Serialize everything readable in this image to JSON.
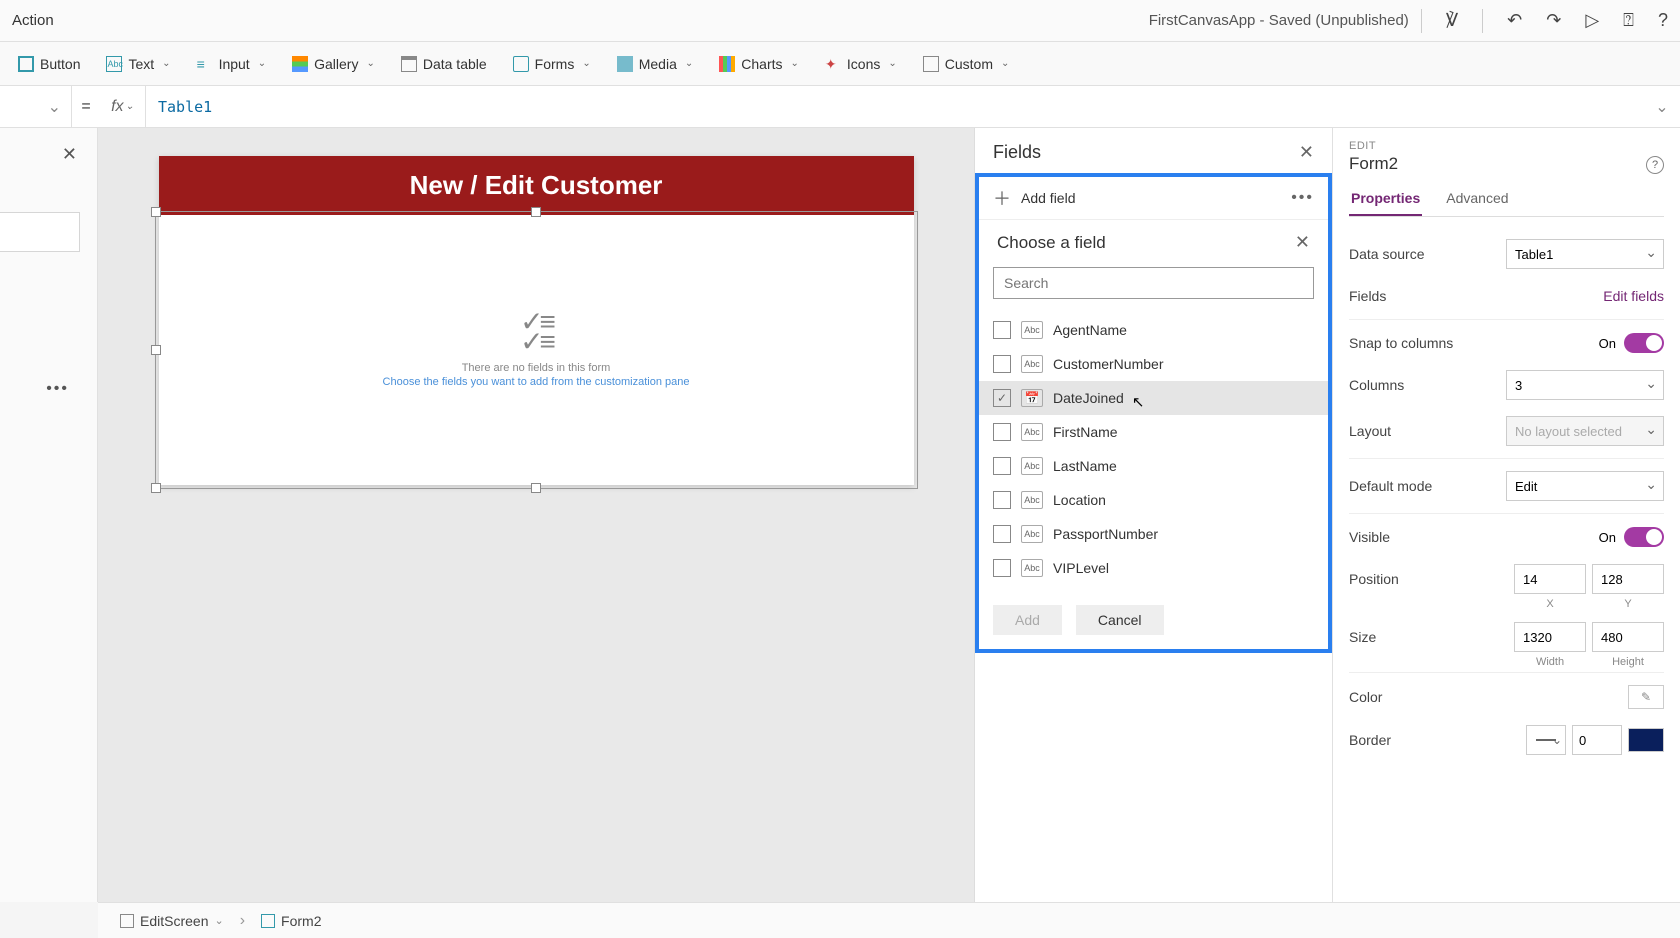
{
  "titlebar": {
    "action": "Action",
    "appTitle": "FirstCanvasApp - Saved (Unpublished)"
  },
  "toolbar": {
    "button": "Button",
    "text": "Text",
    "input": "Input",
    "gallery": "Gallery",
    "dataTable": "Data table",
    "forms": "Forms",
    "media": "Media",
    "charts": "Charts",
    "icons": "Icons",
    "custom": "Custom"
  },
  "formula": {
    "value": "Table1"
  },
  "canvas": {
    "header": "New / Edit Customer",
    "phLine1": "There are no fields in this form",
    "phLine2": "Choose the fields you want to add from the customization pane"
  },
  "fieldsPane": {
    "title": "Fields",
    "addField": "Add field",
    "chooseTitle": "Choose a field",
    "searchPlaceholder": "Search",
    "fields": [
      {
        "name": "AgentName",
        "type": "Abc",
        "checked": false
      },
      {
        "name": "CustomerNumber",
        "type": "Abc",
        "checked": false
      },
      {
        "name": "DateJoined",
        "type": "date",
        "checked": true
      },
      {
        "name": "FirstName",
        "type": "Abc",
        "checked": false
      },
      {
        "name": "LastName",
        "type": "Abc",
        "checked": false
      },
      {
        "name": "Location",
        "type": "Abc",
        "checked": false
      },
      {
        "name": "PassportNumber",
        "type": "Abc",
        "checked": false
      },
      {
        "name": "VIPLevel",
        "type": "Abc",
        "checked": false
      }
    ],
    "addBtn": "Add",
    "cancelBtn": "Cancel"
  },
  "props": {
    "editLabel": "EDIT",
    "formName": "Form2",
    "tabProperties": "Properties",
    "tabAdvanced": "Advanced",
    "dataSourceLabel": "Data source",
    "dataSourceValue": "Table1",
    "fieldsLabel": "Fields",
    "editFieldsLink": "Edit fields",
    "snapLabel": "Snap to columns",
    "snapValue": "On",
    "columnsLabel": "Columns",
    "columnsValue": "3",
    "layoutLabel": "Layout",
    "layoutValue": "No layout selected",
    "defaultModeLabel": "Default mode",
    "defaultModeValue": "Edit",
    "visibleLabel": "Visible",
    "visibleValue": "On",
    "positionLabel": "Position",
    "posX": "14",
    "posY": "128",
    "posXLabel": "X",
    "posYLabel": "Y",
    "sizeLabel": "Size",
    "sizeW": "1320",
    "sizeH": "480",
    "sizeWLabel": "Width",
    "sizeHLabel": "Height",
    "colorLabel": "Color",
    "borderLabel": "Border",
    "borderWidth": "0",
    "borderColor": "#0a1f5c"
  },
  "breadcrumb": {
    "item1": "EditScreen",
    "item2": "Form2"
  }
}
